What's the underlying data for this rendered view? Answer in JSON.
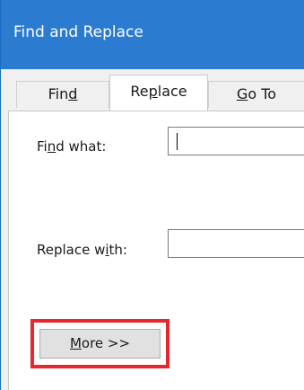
{
  "window": {
    "title": "Find and Replace"
  },
  "tabs": [
    {
      "pre": "Fin",
      "key": "d",
      "post": "",
      "active": false
    },
    {
      "pre": "Re",
      "key": "p",
      "post": "lace",
      "active": true
    },
    {
      "pre": "",
      "key": "G",
      "post": "o To",
      "active": false
    }
  ],
  "fields": {
    "find": {
      "pre": "Fi",
      "key": "n",
      "post": "d what:",
      "value": ""
    },
    "replace": {
      "pre": "Replace w",
      "key": "i",
      "post": "th:",
      "value": ""
    }
  },
  "buttons": {
    "more": {
      "pre": "",
      "key": "M",
      "post": "ore >>"
    }
  },
  "colors": {
    "titlebar": "#2b7bd0",
    "highlight": "#e8262d"
  }
}
